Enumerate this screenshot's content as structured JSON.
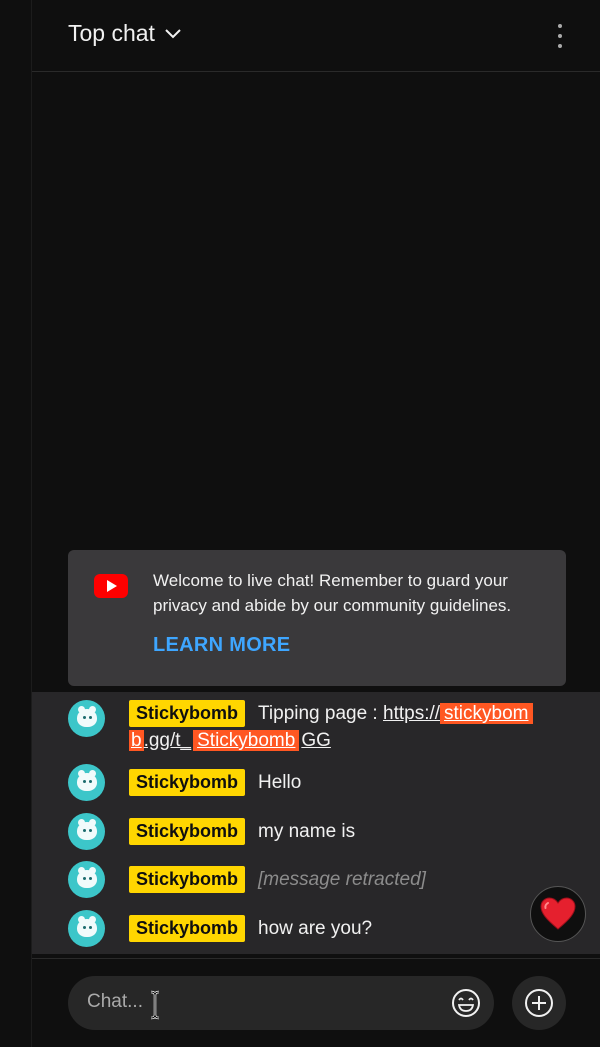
{
  "header": {
    "title": "Top chat"
  },
  "welcome": {
    "text": "Welcome to live chat! Remember to guard your privacy and abide by our community guidelines.",
    "learn_more": "LEARN MORE"
  },
  "messages": [
    {
      "author": "Stickybomb",
      "text_prefix": "Tipping page : ",
      "link_parts": [
        "https://",
        "stickybom",
        "b",
        ".gg/t_",
        "Stickybomb",
        "GG"
      ]
    },
    {
      "author": "Stickybomb",
      "text": "Hello"
    },
    {
      "author": "Stickybomb",
      "text": "my name is"
    },
    {
      "author": "Stickybomb",
      "text": "[message retracted]",
      "retracted": true
    },
    {
      "author": "Stickybomb",
      "text": "how are you?"
    }
  ],
  "input": {
    "placeholder": "Chat..."
  },
  "colors": {
    "author_badge": "#ffd600",
    "highlight": "#ff5722",
    "accent_link": "#3ea6ff",
    "avatar": "#3cc6c9"
  },
  "icons": {
    "header_dropdown": "chevron-down-icon",
    "more": "more-vert-icon",
    "welcome_logo": "youtube-logo-icon",
    "heart": "heart-icon",
    "emoji": "emoji-icon",
    "add": "plus-circle-icon"
  }
}
